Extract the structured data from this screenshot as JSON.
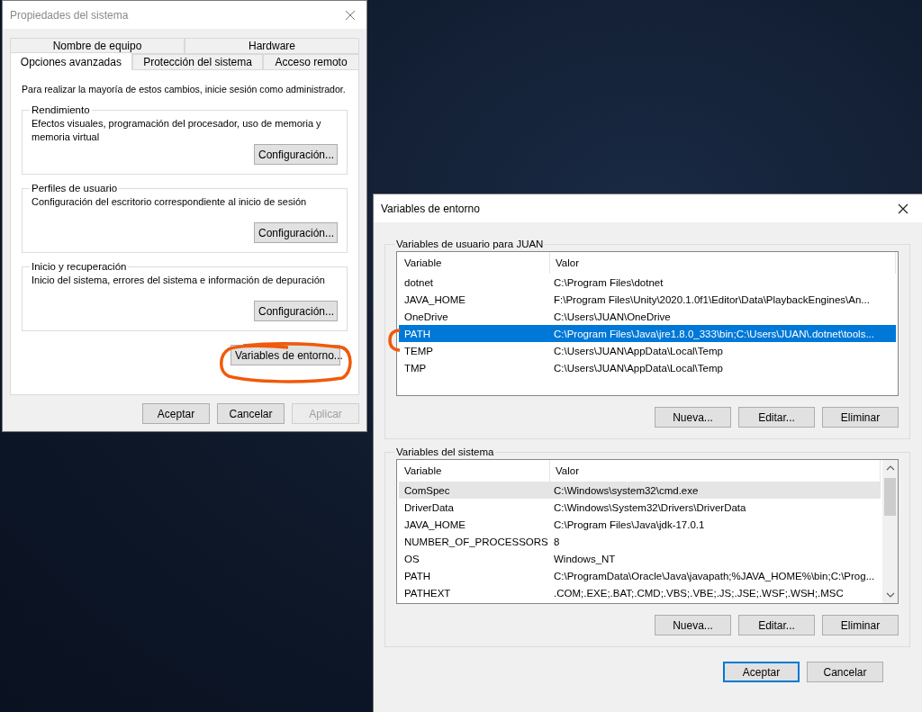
{
  "system_properties": {
    "title": "Propiedades del sistema",
    "tab_rows": [
      [
        {
          "label": "Nombre de equipo",
          "selected": false
        },
        {
          "label": "Hardware",
          "selected": false
        }
      ],
      [
        {
          "label": "Opciones avanzadas",
          "selected": true
        },
        {
          "label": "Protección del sistema",
          "selected": false
        },
        {
          "label": "Acceso remoto",
          "selected": false
        }
      ]
    ],
    "notice": "Para realizar la mayoría de estos cambios, inicie sesión como administrador.",
    "groups": [
      {
        "title": "Rendimiento",
        "text": "Efectos visuales, programación del procesador, uso de memoria y memoria virtual",
        "button": "Configuración..."
      },
      {
        "title": "Perfiles de usuario",
        "text": "Configuración del escritorio correspondiente al inicio de sesión",
        "button": "Configuración..."
      },
      {
        "title": "Inicio y recuperación",
        "text": "Inicio del sistema, errores del sistema e información de depuración",
        "button": "Configuración..."
      }
    ],
    "env_button": "Variables de entorno...",
    "buttons": [
      {
        "label": "Aceptar",
        "disabled": false
      },
      {
        "label": "Cancelar",
        "disabled": false
      },
      {
        "label": "Aplicar",
        "disabled": true
      }
    ]
  },
  "environment_variables": {
    "title": "Variables de entorno",
    "sections": [
      {
        "title": "Variables de usuario para JUAN",
        "focused": true,
        "scrollbar": false,
        "columns": [
          "Variable",
          "Valor"
        ],
        "rows": [
          {
            "name": "dotnet",
            "value": "C:\\Program Files\\dotnet",
            "selected": false
          },
          {
            "name": "JAVA_HOME",
            "value": "F:\\Program Files\\Unity\\2020.1.0f1\\Editor\\Data\\PlaybackEngines\\An...",
            "selected": false
          },
          {
            "name": "OneDrive",
            "value": "C:\\Users\\JUAN\\OneDrive",
            "selected": false
          },
          {
            "name": "PATH",
            "value": "C:\\Program Files\\Java\\jre1.8.0_333\\bin;C:\\Users\\JUAN\\.dotnet\\tools...",
            "selected": true
          },
          {
            "name": "TEMP",
            "value": "C:\\Users\\JUAN\\AppData\\Local\\Temp",
            "selected": false
          },
          {
            "name": "TMP",
            "value": "C:\\Users\\JUAN\\AppData\\Local\\Temp",
            "selected": false
          }
        ],
        "buttons": [
          "Nueva...",
          "Editar...",
          "Eliminar"
        ]
      },
      {
        "title": "Variables del sistema",
        "focused": false,
        "scrollbar": true,
        "columns": [
          "Variable",
          "Valor"
        ],
        "rows": [
          {
            "name": "ComSpec",
            "value": "C:\\Windows\\system32\\cmd.exe",
            "selected": true
          },
          {
            "name": "DriverData",
            "value": "C:\\Windows\\System32\\Drivers\\DriverData",
            "selected": false
          },
          {
            "name": "JAVA_HOME",
            "value": "C:\\Program Files\\Java\\jdk-17.0.1",
            "selected": false
          },
          {
            "name": "NUMBER_OF_PROCESSORS",
            "value": "8",
            "selected": false
          },
          {
            "name": "OS",
            "value": "Windows_NT",
            "selected": false
          },
          {
            "name": "PATH",
            "value": "C:\\ProgramData\\Oracle\\Java\\javapath;%JAVA_HOME%\\bin;C:\\Prog...",
            "selected": false
          },
          {
            "name": "PATHEXT",
            "value": ".COM;.EXE;.BAT;.CMD;.VBS;.VBE;.JS;.JSE;.WSF;.WSH;.MSC",
            "selected": false
          }
        ],
        "buttons": [
          "Nueva...",
          "Editar...",
          "Eliminar"
        ]
      }
    ],
    "buttons": [
      {
        "label": "Aceptar",
        "default": true
      },
      {
        "label": "Cancelar",
        "default": false
      }
    ]
  }
}
